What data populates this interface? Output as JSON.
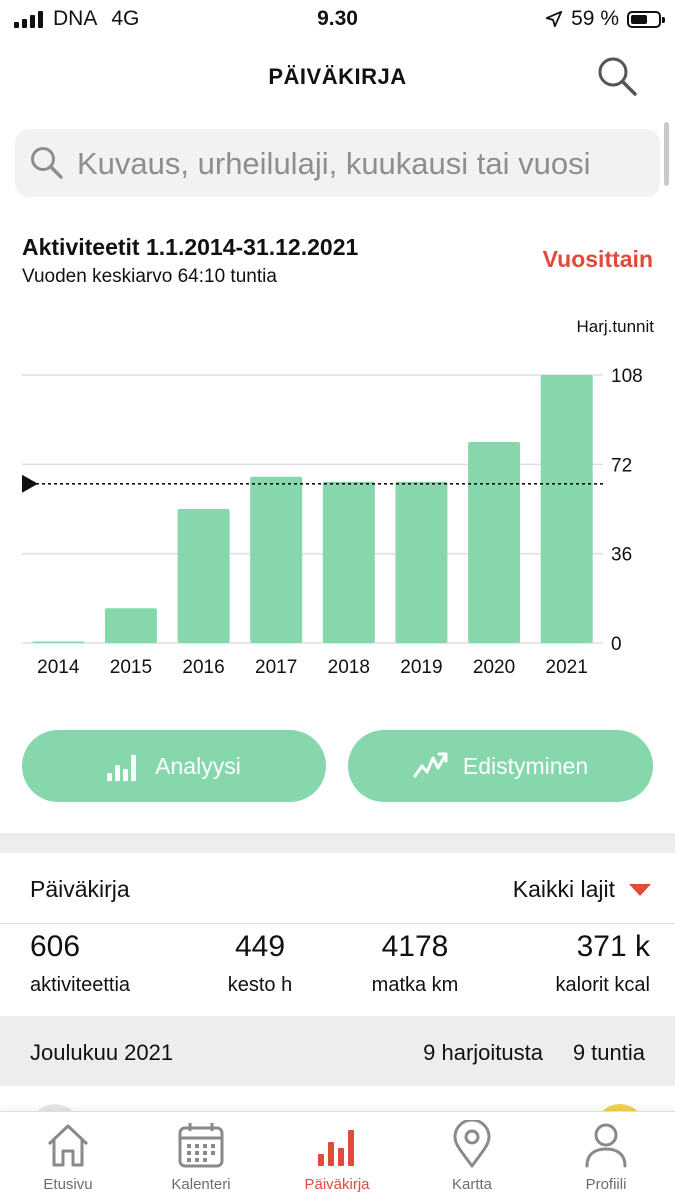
{
  "status_bar": {
    "carrier": "DNA",
    "network": "4G",
    "time": "9.30",
    "battery_percent": "59 %"
  },
  "header": {
    "title": "PÄIVÄKIRJA"
  },
  "search": {
    "placeholder": "Kuvaus, urheilulaji, kuukausi tai vuosi"
  },
  "summary": {
    "title": "Aktiviteetit 1.1.2014-31.12.2021",
    "subtitle": "Vuoden keskiarvo 64:10 tuntia",
    "period_toggle": "Vuosittain"
  },
  "chart_data": {
    "type": "bar",
    "unit_label": "Harj.tunnit",
    "categories": [
      "2014",
      "2015",
      "2016",
      "2017",
      "2018",
      "2019",
      "2020",
      "2021"
    ],
    "values": [
      0.5,
      14,
      54,
      67,
      65,
      65,
      81,
      108
    ],
    "average": 64.17,
    "yticks": [
      0,
      36,
      72,
      108
    ],
    "ylim": [
      0,
      108
    ],
    "grid": true,
    "bar_color": "#86d7ac",
    "axis_position": "right"
  },
  "buttons": {
    "analysis": "Analyysi",
    "progress": "Edistyminen"
  },
  "diary": {
    "title": "Päiväkirja",
    "filter": "Kaikki lajit",
    "stats": [
      {
        "value": "606",
        "label": "aktiviteettia"
      },
      {
        "value": "449",
        "label": "kesto h"
      },
      {
        "value": "4178",
        "label": "matka km"
      },
      {
        "value": "371 k",
        "label": "kalorit kcal"
      }
    ],
    "month": {
      "name": "Joulukuu 2021",
      "workouts": "9 harjoitusta",
      "hours": "9 tuntia"
    }
  },
  "tabbar": {
    "items": [
      {
        "label": "Etusivu",
        "icon": "home-icon"
      },
      {
        "label": "Kalenteri",
        "icon": "calendar-icon"
      },
      {
        "label": "Päiväkirja",
        "icon": "bar-chart-icon",
        "active": true
      },
      {
        "label": "Kartta",
        "icon": "map-pin-icon"
      },
      {
        "label": "Profiili",
        "icon": "profile-icon"
      }
    ]
  },
  "colors": {
    "accent": "#e04a3a",
    "bars": "#86d7ac",
    "band": "#ededed"
  }
}
